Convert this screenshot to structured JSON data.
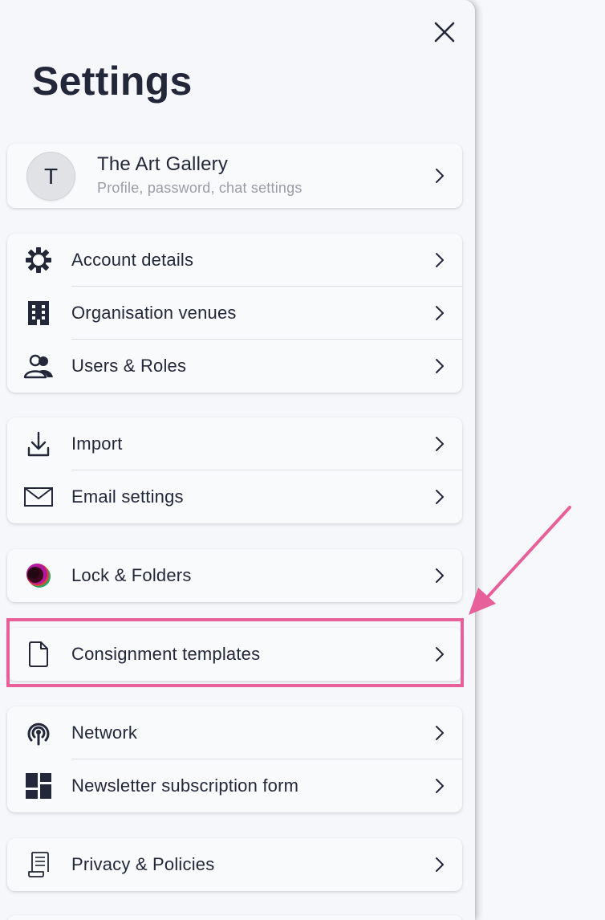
{
  "header": {
    "title": "Settings",
    "close_icon": "close-icon"
  },
  "profile": {
    "initial": "T",
    "name": "The Art Gallery",
    "subtitle": "Profile, password, chat settings"
  },
  "groups": [
    {
      "items": [
        {
          "label": "Account details",
          "icon": "gear-icon"
        },
        {
          "label": "Organisation venues",
          "icon": "building-icon"
        },
        {
          "label": "Users & Roles",
          "icon": "users-icon"
        }
      ]
    },
    {
      "items": [
        {
          "label": "Import",
          "icon": "download-icon"
        },
        {
          "label": "Email settings",
          "icon": "envelope-icon"
        }
      ]
    },
    {
      "items": [
        {
          "label": "Lock & Folders",
          "icon": "lock-folders-logo-icon"
        }
      ]
    },
    {
      "items": [
        {
          "label": "Consignment templates",
          "icon": "document-icon"
        }
      ]
    },
    {
      "items": [
        {
          "label": "Network",
          "icon": "broadcast-icon"
        },
        {
          "label": "Newsletter subscription form",
          "icon": "dashboard-icon"
        }
      ]
    },
    {
      "items": [
        {
          "label": "Privacy & Policies",
          "icon": "scroll-icon"
        }
      ]
    }
  ],
  "annotation": {
    "highlight_color": "#e8609a",
    "arrow_color": "#e8609a"
  },
  "colors": {
    "panel_background": "#f6f7fa",
    "text": "#22273a",
    "subtext": "#9a9ca6",
    "divider": "#d9dbe1"
  }
}
